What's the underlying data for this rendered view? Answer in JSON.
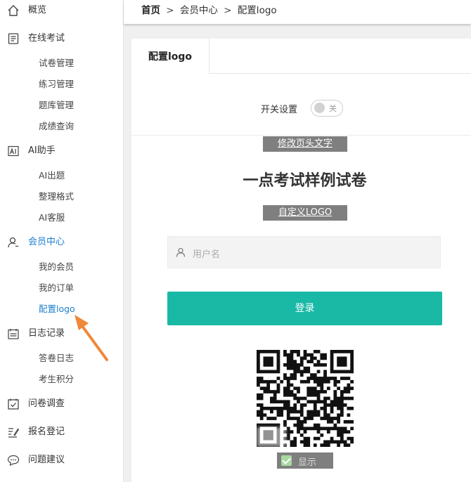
{
  "sidebar": {
    "overview": "概览",
    "exam": {
      "label": "在线考试",
      "items": [
        "试卷管理",
        "练习管理",
        "题库管理",
        "成绩查询"
      ]
    },
    "ai": {
      "label": "AI助手",
      "items": [
        "AI出题",
        "整理格式",
        "AI客服"
      ]
    },
    "member": {
      "label": "会员中心",
      "items": [
        "我的会员",
        "我的订单",
        "配置logo"
      ]
    },
    "log": {
      "label": "日志记录",
      "items": [
        "答卷日志",
        "考生积分"
      ]
    },
    "survey": "问卷调查",
    "signup": "报名登记",
    "feedback": "问题建议",
    "active_color": "#1e7fd0"
  },
  "breadcrumb": {
    "home": "首页",
    "sep": ">",
    "parent": "会员中心",
    "current": "配置logo"
  },
  "tab": {
    "label": "配置logo"
  },
  "switch": {
    "label": "开关设置",
    "state": "关"
  },
  "edit_header_button": "修改页头文字",
  "page_title": "一点考试样例试卷",
  "custom_logo_button": "自定义LOGO",
  "username_input": {
    "placeholder": "用户名"
  },
  "login_button": "登录",
  "show_checkbox": {
    "label": "显示",
    "checked": true
  },
  "colors": {
    "accent": "#19b9a6",
    "link": "#1e7fd0",
    "arrow": "#f0883a"
  }
}
